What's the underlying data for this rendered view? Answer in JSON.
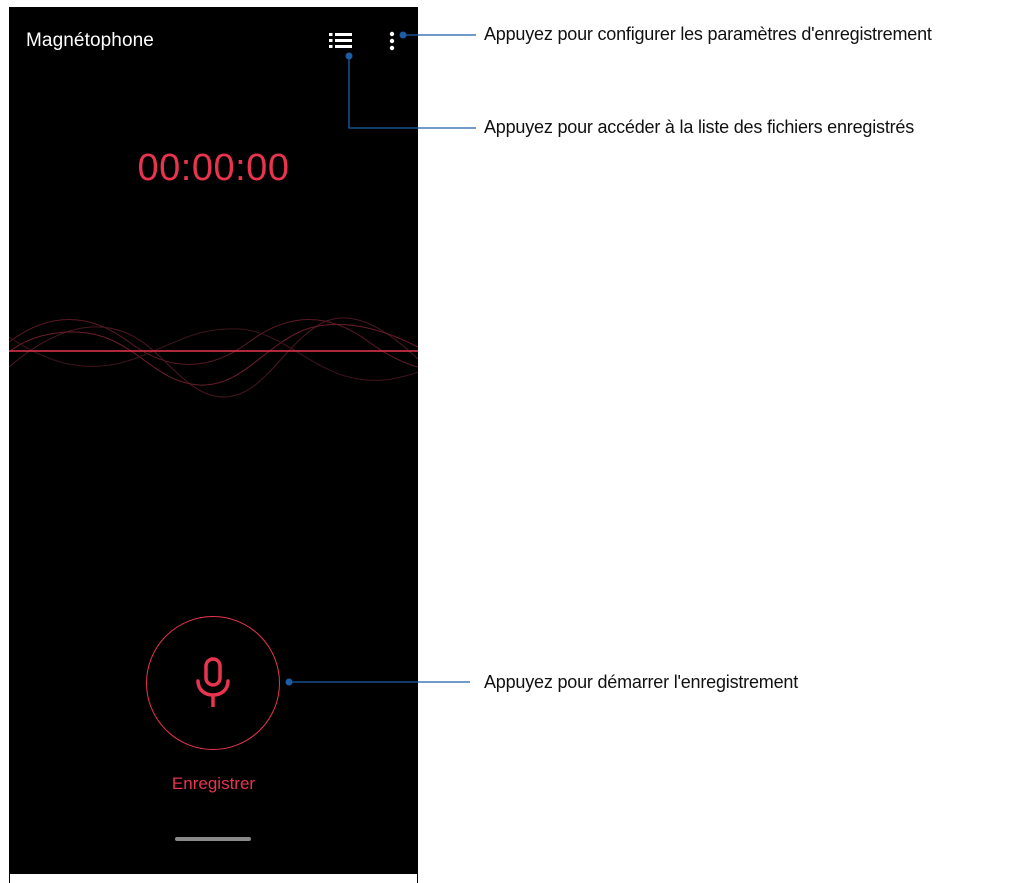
{
  "app": {
    "title": "Magnétophone"
  },
  "toolbar": {
    "list_icon": "list-icon",
    "more_icon": "more-vertical-icon"
  },
  "timer": {
    "value": "00:00:00"
  },
  "record": {
    "icon": "microphone-icon",
    "label": "Enregistrer"
  },
  "callouts": {
    "settings": "Appuyez pour configurer les paramètres d'enregistrement",
    "file_list": "Appuyez pour accéder à la liste des fichiers enregistrés",
    "start_recording": "Appuyez pour démarrer l'enregistrement"
  },
  "colors": {
    "accent": "#e8344e",
    "background": "#000000",
    "callout_line": "#1b5ea6"
  }
}
